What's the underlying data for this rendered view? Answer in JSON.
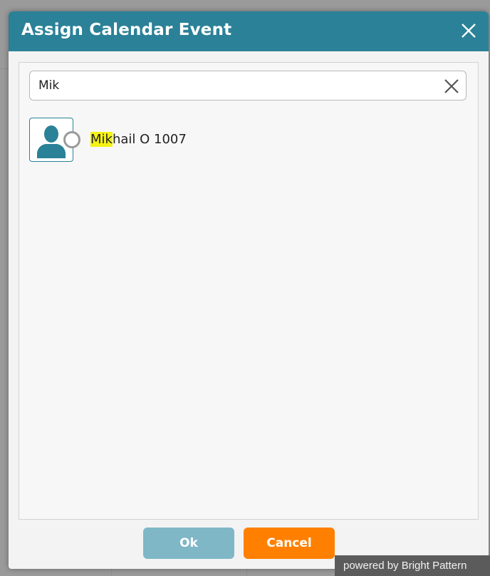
{
  "dialog": {
    "title": "Assign Calendar Event",
    "close_icon": "close-icon"
  },
  "search": {
    "value": "Mik",
    "clear_icon": "clear-icon"
  },
  "results": [
    {
      "name_match": "Mik",
      "name_rest": "hail O 1007",
      "avatar_icon": "user-silhouette-icon",
      "status_icon": "status-circle-icon"
    }
  ],
  "footer": {
    "ok_label": "Ok",
    "cancel_label": "Cancel"
  },
  "branding": {
    "powered_by": "powered by Bright Pattern"
  },
  "colors": {
    "titlebar": "#2b8197",
    "ok_button": "#7fb7c7",
    "cancel_button": "#ff8000",
    "highlight": "#f5f214"
  }
}
